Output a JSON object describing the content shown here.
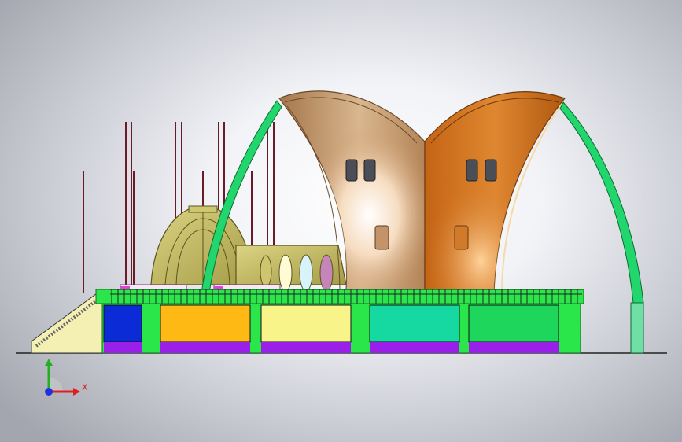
{
  "view": {
    "background_center": "#ffffff",
    "background_edge": "#a3a6ae"
  },
  "triad": {
    "x_label": "X",
    "x_color": "#e02020",
    "y_color": "#20b020",
    "z_color": "#2030e0"
  },
  "palette": {
    "shell_left": "#c99a6b",
    "shell_right": "#cf7424",
    "green_arch": "#22d66e",
    "ground_line": "#222222"
  },
  "base_panels": [
    {
      "name": "panel-blue",
      "color": "#0b2bd6"
    },
    {
      "name": "panel-orange",
      "color": "#ffb915"
    },
    {
      "name": "panel-yellow",
      "color": "#f8f48a"
    },
    {
      "name": "panel-teal",
      "color": "#15d9a0"
    },
    {
      "name": "panel-green",
      "color": "#1fd65c"
    }
  ]
}
